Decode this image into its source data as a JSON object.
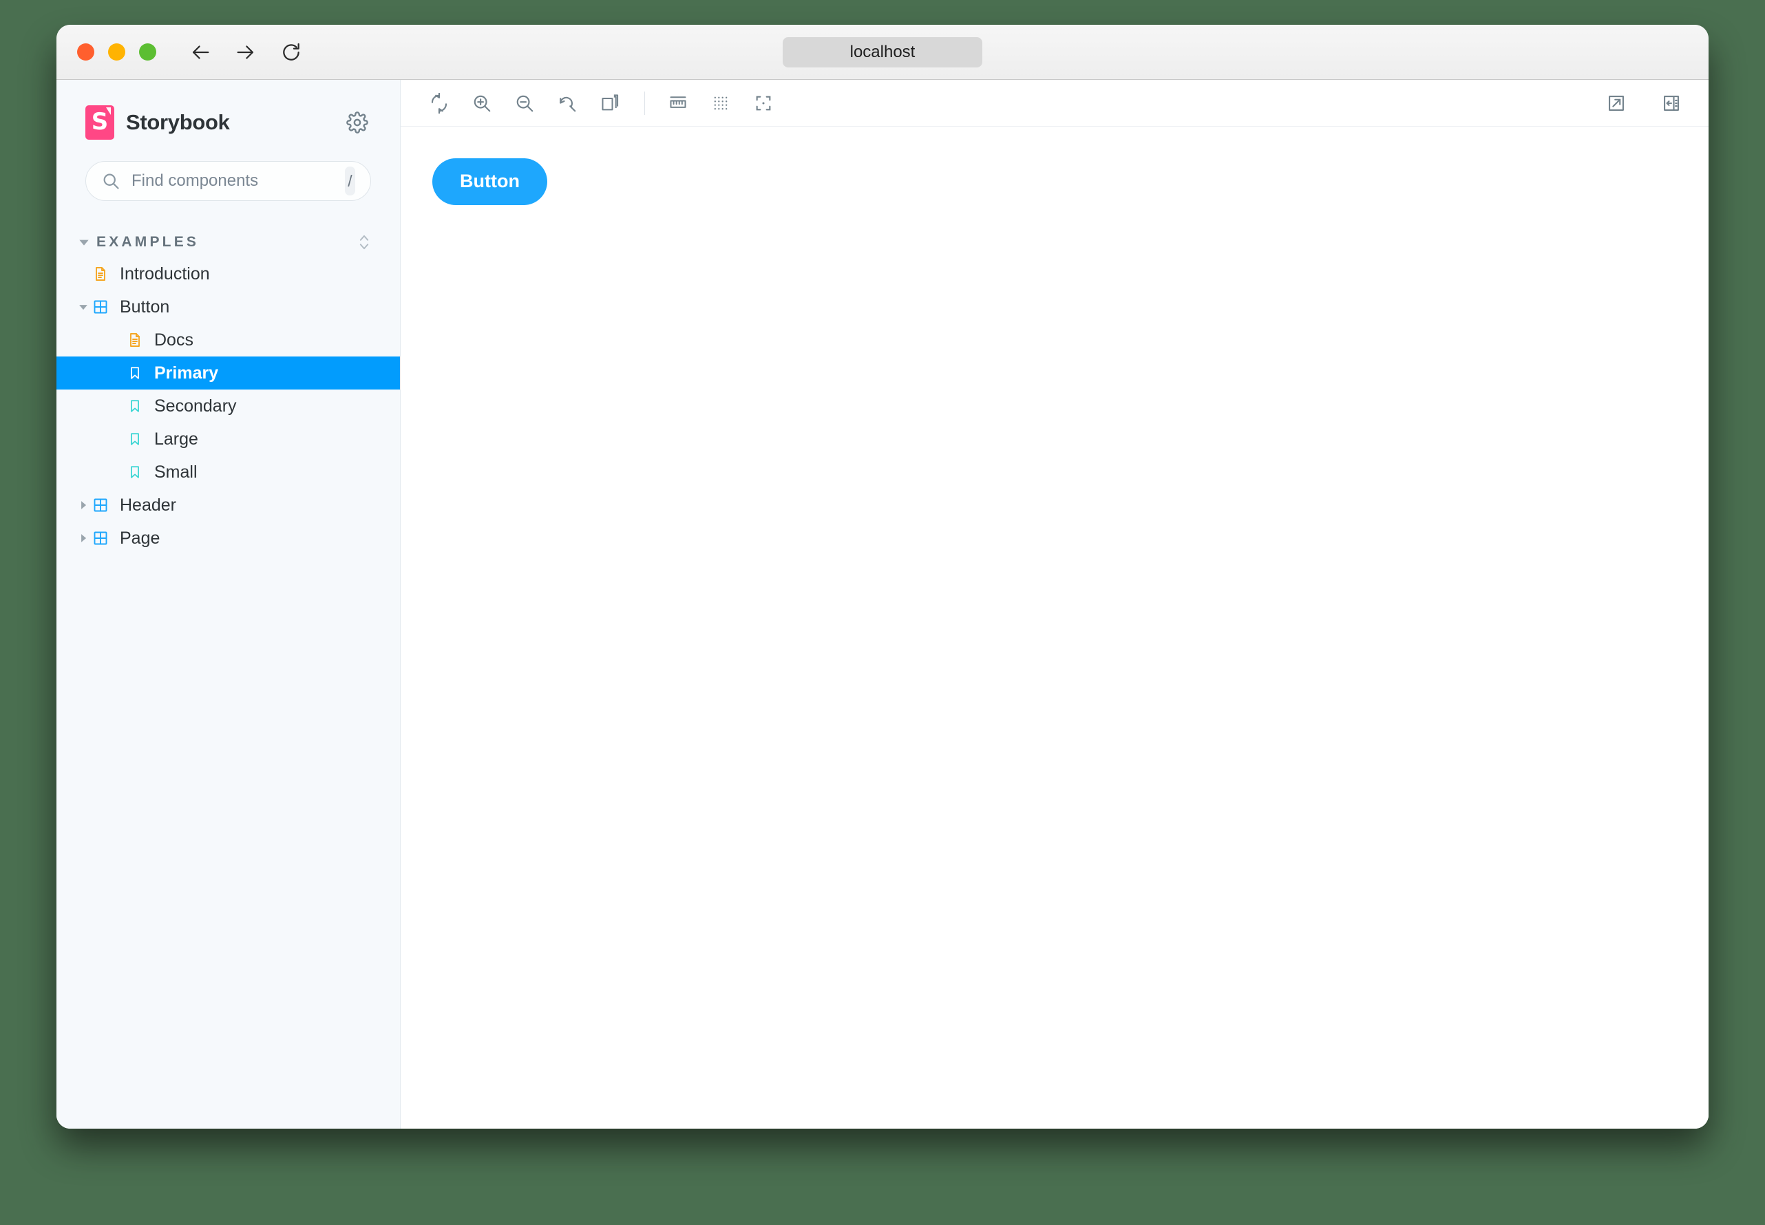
{
  "browser": {
    "url": "localhost",
    "traffic_lights": [
      "close",
      "minimize",
      "maximize"
    ],
    "back_icon": "arrow-left-icon",
    "forward_icon": "arrow-right-icon",
    "reload_icon": "reload-icon"
  },
  "sidebar": {
    "brand": "Storybook",
    "logo_letter": "S",
    "logo_color": "#ff4785",
    "settings_icon": "gear-icon",
    "search": {
      "placeholder": "Find components",
      "value": "",
      "shortcut": "/",
      "icon": "search-icon"
    },
    "group": {
      "label": "EXAMPLES",
      "caret_icon": "caret-down-icon",
      "sort_icon": "chevron-up-down-icon"
    },
    "items": [
      {
        "label": "Introduction",
        "icon": "document-icon",
        "depth": 1,
        "expandable": false,
        "expanded": false,
        "selected": false
      },
      {
        "label": "Button",
        "icon": "component-icon",
        "depth": 1,
        "expandable": true,
        "expanded": true,
        "selected": false
      },
      {
        "label": "Docs",
        "icon": "document-icon",
        "depth": 2,
        "expandable": false,
        "expanded": false,
        "selected": false
      },
      {
        "label": "Primary",
        "icon": "bookmark-icon",
        "depth": 2,
        "expandable": false,
        "expanded": false,
        "selected": true
      },
      {
        "label": "Secondary",
        "icon": "bookmark-icon",
        "depth": 2,
        "expandable": false,
        "expanded": false,
        "selected": false
      },
      {
        "label": "Large",
        "icon": "bookmark-icon",
        "depth": 2,
        "expandable": false,
        "expanded": false,
        "selected": false
      },
      {
        "label": "Small",
        "icon": "bookmark-icon",
        "depth": 2,
        "expandable": false,
        "expanded": false,
        "selected": false
      },
      {
        "label": "Header",
        "icon": "component-icon",
        "depth": 1,
        "expandable": true,
        "expanded": false,
        "selected": false
      },
      {
        "label": "Page",
        "icon": "component-icon",
        "depth": 1,
        "expandable": true,
        "expanded": false,
        "selected": false
      }
    ]
  },
  "toolbar": {
    "left": [
      {
        "name": "remount-button",
        "icon": "remount-icon"
      },
      {
        "name": "zoom-in-button",
        "icon": "zoom-in-icon"
      },
      {
        "name": "zoom-out-button",
        "icon": "zoom-out-icon"
      },
      {
        "name": "zoom-reset-button",
        "icon": "zoom-reset-icon"
      },
      {
        "name": "backgrounds-button",
        "icon": "stacked-squares-icon"
      }
    ],
    "addons": [
      {
        "name": "measure-button",
        "icon": "ruler-icon"
      },
      {
        "name": "grid-button",
        "icon": "grid-dots-icon"
      },
      {
        "name": "outline-button",
        "icon": "outline-icon"
      }
    ],
    "right": [
      {
        "name": "open-canvas-new-tab-button",
        "icon": "external-link-icon"
      },
      {
        "name": "toggle-addons-panel-button",
        "icon": "panel-right-icon"
      }
    ]
  },
  "preview": {
    "story_button_label": "Button",
    "story_button_color": "#1ea7fd"
  },
  "colors": {
    "page_background": "#4a6f50",
    "sidebar_background": "#f6f9fc",
    "accent_blue": "#029cfd",
    "brand_pink": "#ff4785",
    "doc_icon": "#f5a623",
    "component_icon": "#1ea7fd",
    "story_icon": "#37d5d3"
  }
}
